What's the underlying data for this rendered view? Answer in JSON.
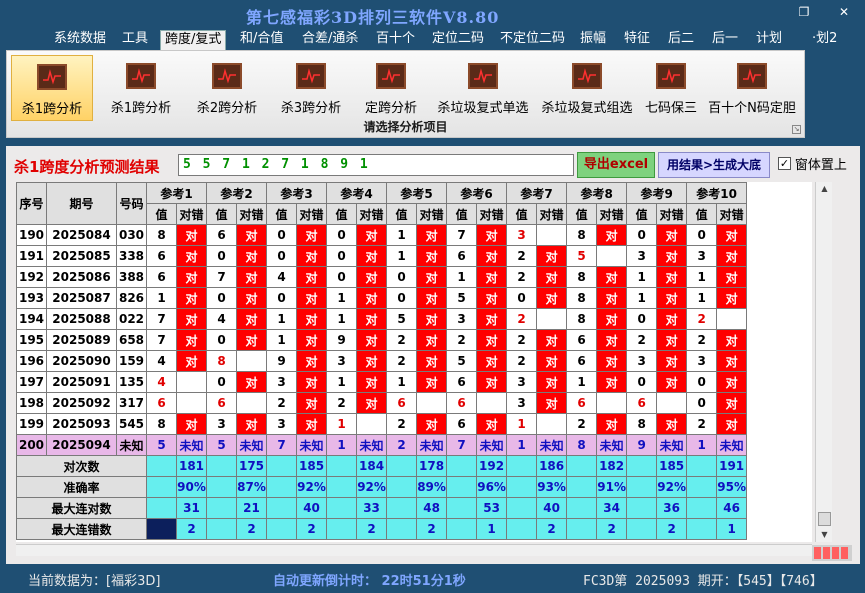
{
  "window": {
    "title": "第七感福彩3D排列三软件V8.80",
    "restore_glyph": "❐",
    "close_glyph": "✕"
  },
  "menu": [
    {
      "label": "系统数据",
      "active": false
    },
    {
      "label": "工具",
      "active": false
    },
    {
      "label": "跨度/复式",
      "active": true
    },
    {
      "label": "和/合值",
      "active": false
    },
    {
      "label": "合差/通杀",
      "active": false
    },
    {
      "label": "百十个",
      "active": false
    },
    {
      "label": "定位二码",
      "active": false
    },
    {
      "label": "不定位二码",
      "active": false
    },
    {
      "label": "振幅",
      "active": false
    },
    {
      "label": "特征",
      "active": false
    },
    {
      "label": "后二",
      "active": false
    },
    {
      "label": "后一",
      "active": false
    },
    {
      "label": "计划",
      "active": false
    },
    {
      "label": "·划2",
      "active": false
    }
  ],
  "ribbon": {
    "items": [
      {
        "label": "杀1跨分析",
        "selected": true
      },
      {
        "label": "杀1跨分析",
        "selected": false
      },
      {
        "label": "杀2跨分析",
        "selected": false
      },
      {
        "label": "杀3跨分析",
        "selected": false
      },
      {
        "label": "定跨分析",
        "selected": false
      },
      {
        "label": "杀垃圾复式单选",
        "selected": false
      },
      {
        "label": "杀垃圾复式组选",
        "selected": false
      },
      {
        "label": "七码保三",
        "selected": false
      },
      {
        "label": "百十个N码定胆",
        "selected": false
      }
    ],
    "group_label": "请选择分析项目",
    "expand_glyph": "↘"
  },
  "panel": {
    "title": "杀1跨度分析预测结果",
    "result_value": "5 5 7 1 2 7 1 8 9 1",
    "export_label": "导出excel",
    "generate_label": "用结果>生成大底",
    "checkbox_label": "窗体置上",
    "checkbox_checked": true,
    "checkbox_glyph": "✓"
  },
  "table": {
    "headers": {
      "seq": "序号",
      "period": "期号",
      "number": "号码",
      "ref_prefix": "参考",
      "value": "值",
      "check": "对错"
    },
    "ref_count": 10,
    "hit_text": "对",
    "rows": [
      {
        "seq": "190",
        "period": "2025084",
        "number": "030",
        "cells": [
          [
            "8",
            "对"
          ],
          [
            "6",
            "对"
          ],
          [
            "0",
            "对"
          ],
          [
            "0",
            "对"
          ],
          [
            "1",
            "对"
          ],
          [
            "7",
            "对"
          ],
          [
            "3",
            ""
          ],
          [
            "8",
            "对"
          ],
          [
            "0",
            "对"
          ],
          [
            "0",
            "对"
          ]
        ],
        "red": [
          6
        ]
      },
      {
        "seq": "191",
        "period": "2025085",
        "number": "338",
        "cells": [
          [
            "6",
            "对"
          ],
          [
            "0",
            "对"
          ],
          [
            "0",
            "对"
          ],
          [
            "0",
            "对"
          ],
          [
            "1",
            "对"
          ],
          [
            "6",
            "对"
          ],
          [
            "2",
            "对"
          ],
          [
            "5",
            ""
          ],
          [
            "3",
            "对"
          ],
          [
            "3",
            "对"
          ]
        ],
        "red": [
          7
        ]
      },
      {
        "seq": "192",
        "period": "2025086",
        "number": "388",
        "cells": [
          [
            "6",
            "对"
          ],
          [
            "7",
            "对"
          ],
          [
            "4",
            "对"
          ],
          [
            "0",
            "对"
          ],
          [
            "0",
            "对"
          ],
          [
            "1",
            "对"
          ],
          [
            "2",
            "对"
          ],
          [
            "8",
            "对"
          ],
          [
            "1",
            "对"
          ],
          [
            "1",
            "对"
          ]
        ],
        "red": []
      },
      {
        "seq": "193",
        "period": "2025087",
        "number": "826",
        "cells": [
          [
            "1",
            "对"
          ],
          [
            "0",
            "对"
          ],
          [
            "0",
            "对"
          ],
          [
            "1",
            "对"
          ],
          [
            "0",
            "对"
          ],
          [
            "5",
            "对"
          ],
          [
            "0",
            "对"
          ],
          [
            "8",
            "对"
          ],
          [
            "1",
            "对"
          ],
          [
            "1",
            "对"
          ]
        ],
        "red": []
      },
      {
        "seq": "194",
        "period": "2025088",
        "number": "022",
        "cells": [
          [
            "7",
            "对"
          ],
          [
            "4",
            "对"
          ],
          [
            "1",
            "对"
          ],
          [
            "1",
            "对"
          ],
          [
            "5",
            "对"
          ],
          [
            "3",
            "对"
          ],
          [
            "2",
            ""
          ],
          [
            "8",
            "对"
          ],
          [
            "0",
            "对"
          ],
          [
            "2",
            ""
          ]
        ],
        "red": [
          6,
          9
        ]
      },
      {
        "seq": "195",
        "period": "2025089",
        "number": "658",
        "cells": [
          [
            "7",
            "对"
          ],
          [
            "0",
            "对"
          ],
          [
            "1",
            "对"
          ],
          [
            "9",
            "对"
          ],
          [
            "2",
            "对"
          ],
          [
            "2",
            "对"
          ],
          [
            "2",
            "对"
          ],
          [
            "6",
            "对"
          ],
          [
            "2",
            "对"
          ],
          [
            "2",
            "对"
          ]
        ],
        "red": []
      },
      {
        "seq": "196",
        "period": "2025090",
        "number": "159",
        "cells": [
          [
            "4",
            "对"
          ],
          [
            "8",
            ""
          ],
          [
            "9",
            "对"
          ],
          [
            "3",
            "对"
          ],
          [
            "2",
            "对"
          ],
          [
            "5",
            "对"
          ],
          [
            "2",
            "对"
          ],
          [
            "6",
            "对"
          ],
          [
            "3",
            "对"
          ],
          [
            "3",
            "对"
          ]
        ],
        "red": [
          1
        ]
      },
      {
        "seq": "197",
        "period": "2025091",
        "number": "135",
        "cells": [
          [
            "4",
            ""
          ],
          [
            "0",
            "对"
          ],
          [
            "3",
            "对"
          ],
          [
            "1",
            "对"
          ],
          [
            "1",
            "对"
          ],
          [
            "6",
            "对"
          ],
          [
            "3",
            "对"
          ],
          [
            "1",
            "对"
          ],
          [
            "0",
            "对"
          ],
          [
            "0",
            "对"
          ]
        ],
        "red": [
          0
        ]
      },
      {
        "seq": "198",
        "period": "2025092",
        "number": "317",
        "cells": [
          [
            "6",
            ""
          ],
          [
            "6",
            ""
          ],
          [
            "2",
            "对"
          ],
          [
            "2",
            "对"
          ],
          [
            "6",
            ""
          ],
          [
            "6",
            ""
          ],
          [
            "3",
            "对"
          ],
          [
            "6",
            ""
          ],
          [
            "6",
            ""
          ],
          [
            "0",
            "对"
          ]
        ],
        "red": [
          0,
          1,
          4,
          5,
          7,
          8
        ]
      },
      {
        "seq": "199",
        "period": "2025093",
        "number": "545",
        "cells": [
          [
            "8",
            "对"
          ],
          [
            "3",
            "对"
          ],
          [
            "3",
            "对"
          ],
          [
            "1",
            ""
          ],
          [
            "2",
            "对"
          ],
          [
            "6",
            "对"
          ],
          [
            "1",
            ""
          ],
          [
            "2",
            "对"
          ],
          [
            "8",
            "对"
          ],
          [
            "2",
            "对"
          ]
        ],
        "red": [
          3,
          6
        ]
      }
    ],
    "future_row": {
      "seq": "200",
      "period": "2025094",
      "number": "未知",
      "cells": [
        [
          "5",
          "未知"
        ],
        [
          "5",
          "未知"
        ],
        [
          "7",
          "未知"
        ],
        [
          "1",
          "未知"
        ],
        [
          "2",
          "未知"
        ],
        [
          "7",
          "未知"
        ],
        [
          "1",
          "未知"
        ],
        [
          "8",
          "未知"
        ],
        [
          "9",
          "未知"
        ],
        [
          "1",
          "未知"
        ]
      ]
    },
    "stats": [
      {
        "label": "对次数",
        "values": [
          "181",
          "175",
          "185",
          "184",
          "178",
          "192",
          "186",
          "182",
          "185",
          "191"
        ]
      },
      {
        "label": "准确率",
        "values": [
          "90%",
          "87%",
          "92%",
          "92%",
          "89%",
          "96%",
          "93%",
          "91%",
          "92%",
          "95%"
        ]
      },
      {
        "label": "最大连对数",
        "values": [
          "31",
          "21",
          "40",
          "33",
          "48",
          "53",
          "40",
          "34",
          "36",
          "46"
        ]
      },
      {
        "label": "最大连错数",
        "values": [
          "2",
          "2",
          "2",
          "2",
          "2",
          "1",
          "2",
          "2",
          "2",
          "1"
        ]
      }
    ]
  },
  "status": {
    "current_data": "当前数据为：[福彩3D]",
    "countdown": "自动更新倒计时：  22时51分1秒",
    "draw_info": "FC3D第 2025093 期开：【545】【746】"
  },
  "colors": {
    "hit": "#ff0000",
    "future": "#e8b8e8",
    "stats": "#66eeee",
    "accent_title": "#e00000"
  }
}
